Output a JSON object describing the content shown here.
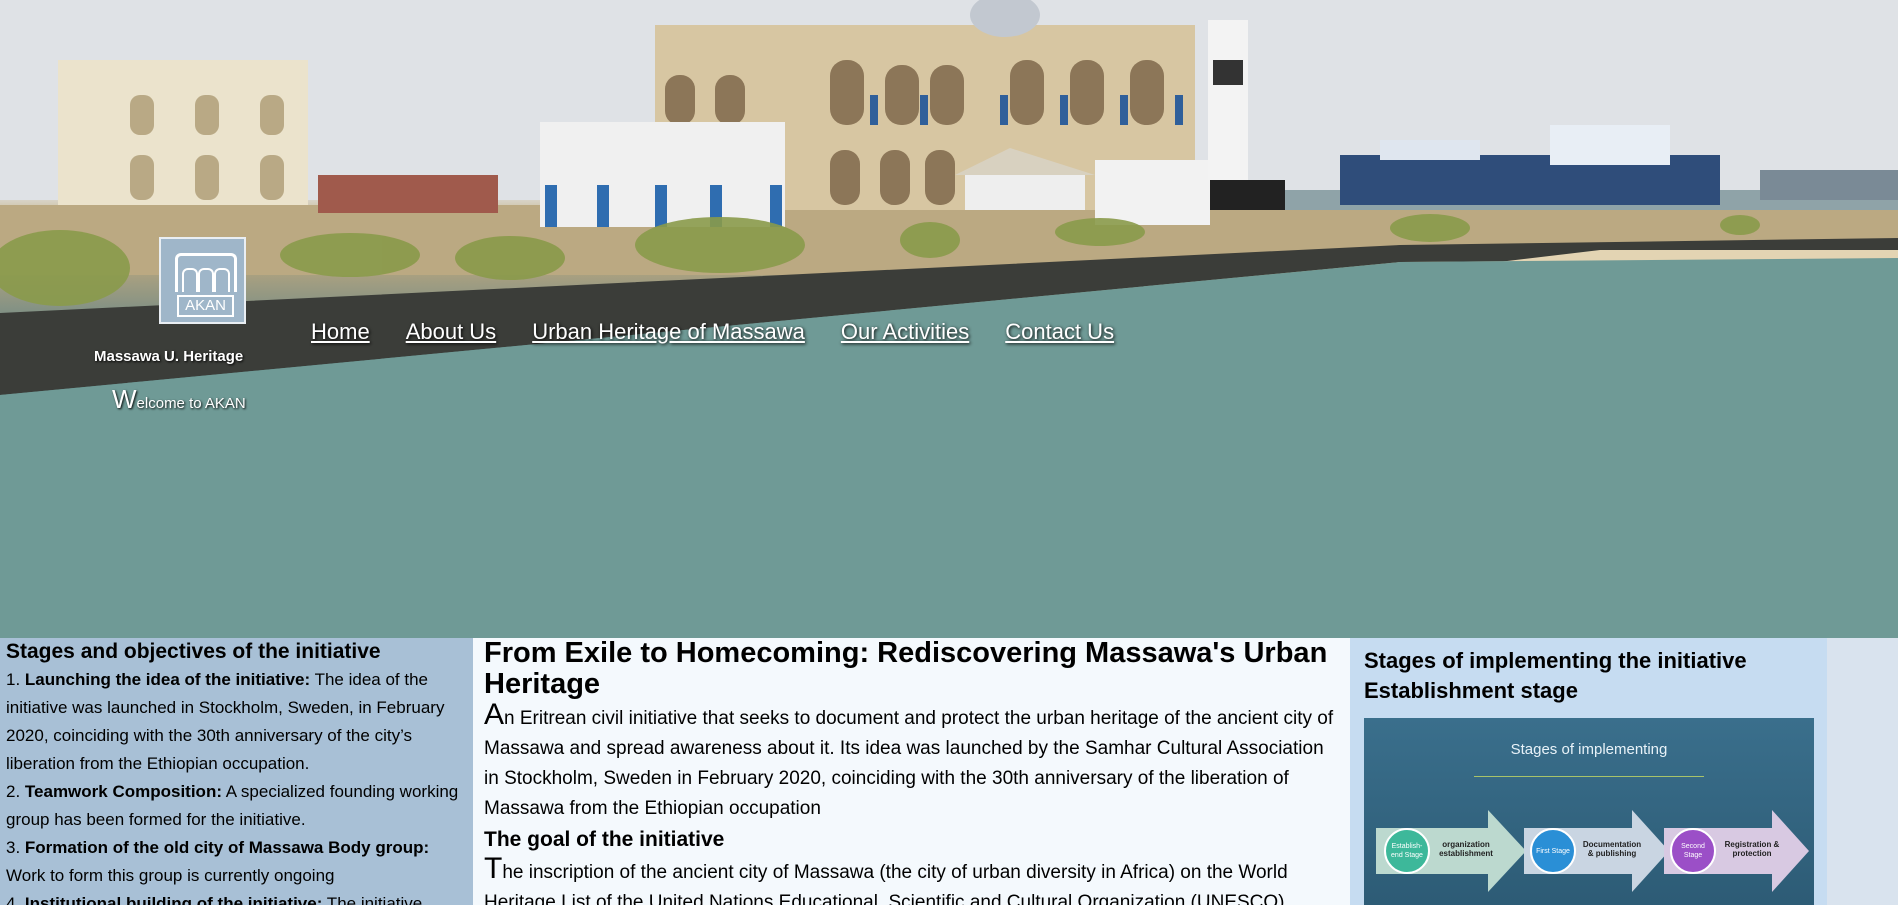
{
  "header": {
    "logo_text": "AKAN",
    "site_name": "Massawa U. Heritage",
    "welcome_first": "W",
    "welcome_rest": "elcome to AKAN",
    "nav": [
      "Home",
      "About Us",
      "Urban Heritage of Massawa",
      "Our Activities",
      "Contact Us"
    ]
  },
  "left": {
    "title": "Stages and objectives of the initiative",
    "items": [
      {
        "num": "1. ",
        "bold": "Launching the idea of the initiative:",
        "text": " The idea of the initiative was launched in Stockholm, Sweden, in February 2020, coinciding with the 30th anniversary of the city’s liberation from the Ethiopian occupation."
      },
      {
        "num": "2. ",
        "bold": "Teamwork Composition:",
        "text": " A specialized founding working group has been formed for the initiative."
      },
      {
        "num": "3. ",
        "bold": "Formation of the old city of Massawa Body group:",
        "text": " Work to form this group is currently ongoing"
      },
      {
        "num": "4. ",
        "bold": "Institutional building of the initiative:",
        "text": " The initiative"
      }
    ]
  },
  "middle": {
    "title": "From Exile to Homecoming: Rediscovering Massawa's Urban Heritage",
    "p1_first": "A",
    "p1_rest": "n Eritrean civil initiative that seeks to document and protect the urban heritage of the ancient city of Massawa and spread awareness about it. Its idea was launched by the Samhar Cultural Association in Stockholm, Sweden in February 2020, coinciding with the 30th anniversary of the liberation of Massawa from the Ethiopian occupation",
    "goal_title": "The goal of the initiative",
    "p2_first": "T",
    "p2_rest": "he inscription of the ancient city of Massawa (the city of urban diversity in Africa) on the World Heritage List of the United Nations Educational, Scientific and Cultural Organization (UNESCO)"
  },
  "right": {
    "title_line1": "Stages of implementing the initiative",
    "title_line2": "Establishment stage",
    "slide": {
      "title": "Stages of implementing",
      "steps": [
        {
          "circle": "Establish-end Stage",
          "label": "organization establishment",
          "color": "#3db89a"
        },
        {
          "circle": "First Stage",
          "label": "Documentation & publishing",
          "color": "#2a8fd6"
        },
        {
          "circle": "Second Stage",
          "label": "Registration & protection",
          "color": "#9b4fc7"
        }
      ]
    }
  }
}
